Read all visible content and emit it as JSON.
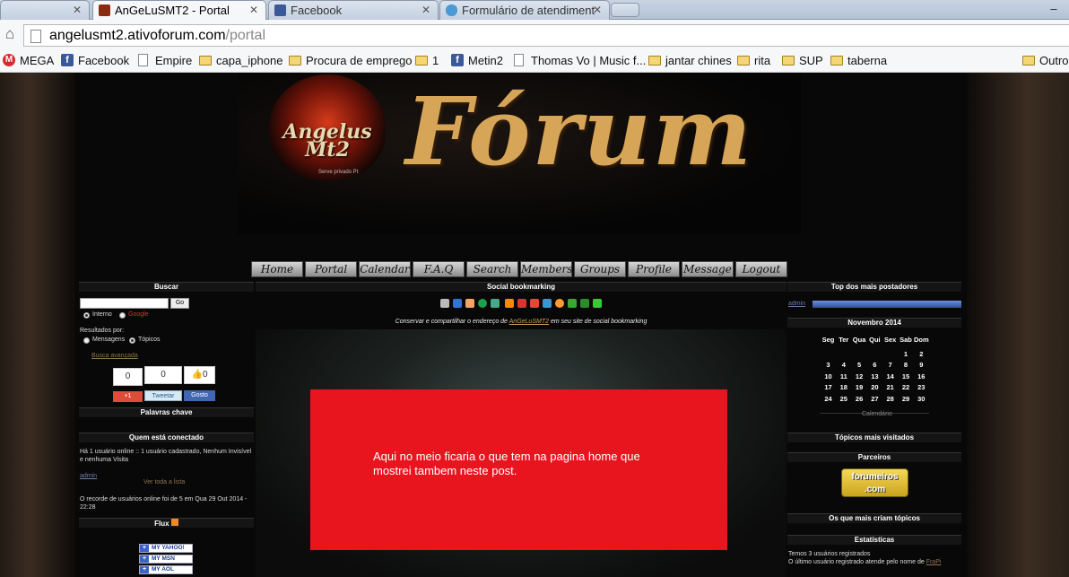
{
  "tabs": [
    {
      "label": "AnGeLuSMT2 - Portal",
      "active": true
    },
    {
      "label": "Facebook",
      "active": false
    },
    {
      "label": "Formulário de atendiment",
      "active": false
    }
  ],
  "window": {
    "minimize_label": "–"
  },
  "address": {
    "host": "angelusmt2.ativoforum.com",
    "path": "/portal"
  },
  "bookmarks": [
    {
      "label": "MEGA",
      "icon": "mega-icon"
    },
    {
      "label": "Facebook",
      "icon": "facebook-icon"
    },
    {
      "label": "Empire",
      "icon": "page-icon"
    },
    {
      "label": "capa_iphone",
      "icon": "folder-icon"
    },
    {
      "label": "Procura de emprego",
      "icon": "folder-icon"
    },
    {
      "label": "1",
      "icon": "folder-icon"
    },
    {
      "label": "Metin2",
      "icon": "facebook-icon"
    },
    {
      "label": "Thomas Vo | Music f...",
      "icon": "page-icon"
    },
    {
      "label": "jantar chines",
      "icon": "folder-icon"
    },
    {
      "label": "rita",
      "icon": "folder-icon"
    },
    {
      "label": "SUP",
      "icon": "folder-icon"
    },
    {
      "label": "taberna",
      "icon": "folder-icon"
    },
    {
      "label": "Outros",
      "icon": "folder-icon"
    }
  ],
  "logo": {
    "text": "Angelus Mt2",
    "sub": "Serve privado Pt"
  },
  "header": {
    "title": "Fórum"
  },
  "nav": [
    "Home",
    "Portal",
    "Calendar",
    "F.A.Q",
    "Search",
    "Members",
    "Groups",
    "Profile",
    "Message",
    "Logout"
  ],
  "left": {
    "search_title": "Buscar",
    "go_label": "Go",
    "opt_interno": "Interno",
    "opt_google": "Google",
    "results_label": "Resultados por:",
    "opt_mensagens": "Mensagens",
    "opt_topicos": "Tópicos",
    "advanced": "Busca avançada",
    "share_counts": [
      "0",
      "0",
      "0"
    ],
    "gplus": "+1",
    "tweet": "Tweetar",
    "gosto": "Gosto",
    "keywords_title": "Palavras chave",
    "online_title": "Quem está conectado",
    "online_text": "Há 1 usuário online :: 1 usuário cadastrado, Nenhum Invisível e nenhuma Visita",
    "online_user": "admin",
    "see_list": "Ver toda a lista",
    "record": "O recorde de usuários online foi de 5 em Qua 29 Out 2014 - 22:28",
    "flux_title": "Flux",
    "flux": [
      "MY YAHOO!",
      "MY MSN",
      "MY AOL"
    ]
  },
  "center": {
    "title": "Social bookmarking",
    "caption_pre": "Conservar e compartilhar o endereço de ",
    "caption_link": "AnGeLuSMT2",
    "caption_post": " em seu site de social bookmarking",
    "message": "Aqui no meio ficaria o que tem na pagina home que mostrei tambem neste post."
  },
  "right": {
    "top_posters_title": "Top dos mais postadores",
    "top_poster": "admin",
    "calendar_title": "Novembro 2014",
    "weekdays": [
      "Seg",
      "Ter",
      "Qua",
      "Qui",
      "Sex",
      "Sab",
      "Dom"
    ],
    "weeks": [
      [
        "",
        "",
        "",
        "",
        "",
        "1",
        "2"
      ],
      [
        "3",
        "4",
        "5",
        "6",
        "7",
        "8",
        "9"
      ],
      [
        "10",
        "11",
        "12",
        "13",
        "14",
        "15",
        "16"
      ],
      [
        "17",
        "18",
        "19",
        "20",
        "21",
        "22",
        "23"
      ],
      [
        "24",
        "25",
        "26",
        "27",
        "28",
        "29",
        "30"
      ]
    ],
    "calendar_link": "Calendário",
    "most_visited_title": "Tópicos mais visitados",
    "partners_title": "Parceiros",
    "partner": "forumeiros .com",
    "most_topics_title": "Os que mais criam tópicos",
    "stats_title": "Estatísticas",
    "stats_line1": "Temos 3 usuários registrados",
    "stats_line2_pre": "O último usuário registrado atende pelo nome de ",
    "stats_line2_user": "FraPi"
  },
  "colors": {
    "red_box": "#e8151f",
    "link": "#c9a25a",
    "accent": "#3b5998"
  }
}
